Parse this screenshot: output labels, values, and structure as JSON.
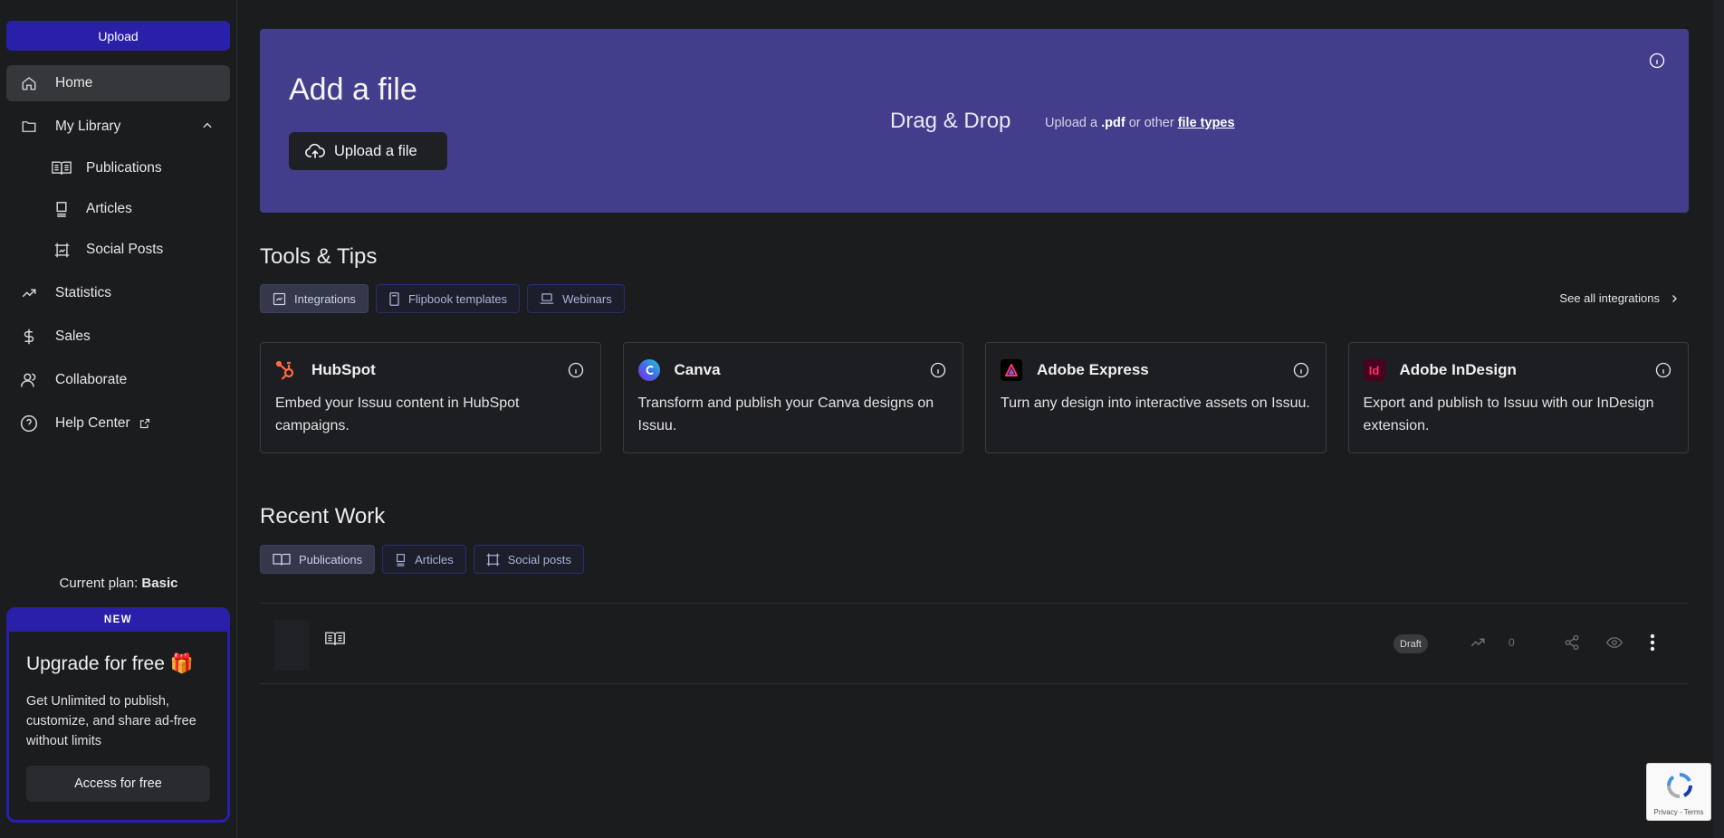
{
  "sidebar": {
    "upload_label": "Upload",
    "nav": {
      "home": "Home",
      "my_library": "My Library",
      "publications": "Publications",
      "articles": "Articles",
      "social_posts": "Social Posts",
      "statistics": "Statistics",
      "sales": "Sales",
      "collaborate": "Collaborate",
      "help_center": "Help Center"
    },
    "plan_label": "Current plan:",
    "plan_value": "Basic",
    "upgrade": {
      "badge": "NEW",
      "title": "Upgrade for free 🎁",
      "description": "Get Unlimited to publish, customize, and share ad-free without limits",
      "button": "Access for free"
    }
  },
  "hero": {
    "title": "Add a file",
    "upload_button": "Upload a file",
    "drag_drop": "Drag & Drop",
    "hint_prefix": "Upload a",
    "hint_pdf": ".pdf",
    "hint_middle": "or other",
    "hint_link": "file types"
  },
  "tools": {
    "title": "Tools & Tips",
    "tabs": [
      "Integrations",
      "Flipbook templates",
      "Webinars"
    ],
    "see_all": "See all integrations",
    "cards": [
      {
        "name": "HubSpot",
        "description": "Embed your Issuu content in HubSpot campaigns."
      },
      {
        "name": "Canva",
        "description": "Transform and publish your Canva designs on Issuu."
      },
      {
        "name": "Adobe Express",
        "description": "Turn any design into interactive assets on Issuu."
      },
      {
        "name": "Adobe InDesign",
        "description": "Export and publish to Issuu with our InDesign extension.",
        "logo_text": "Id"
      }
    ]
  },
  "recent": {
    "title": "Recent Work",
    "tabs": [
      "Publications",
      "Articles",
      "Social posts"
    ],
    "items": [
      {
        "status": "Draft",
        "views": "0"
      }
    ]
  },
  "recaptcha": {
    "text": "Privacy - Terms"
  },
  "colors": {
    "accent": "#2a1fa8",
    "hero_bg": "#433e8c",
    "background": "#1b1c1e"
  }
}
